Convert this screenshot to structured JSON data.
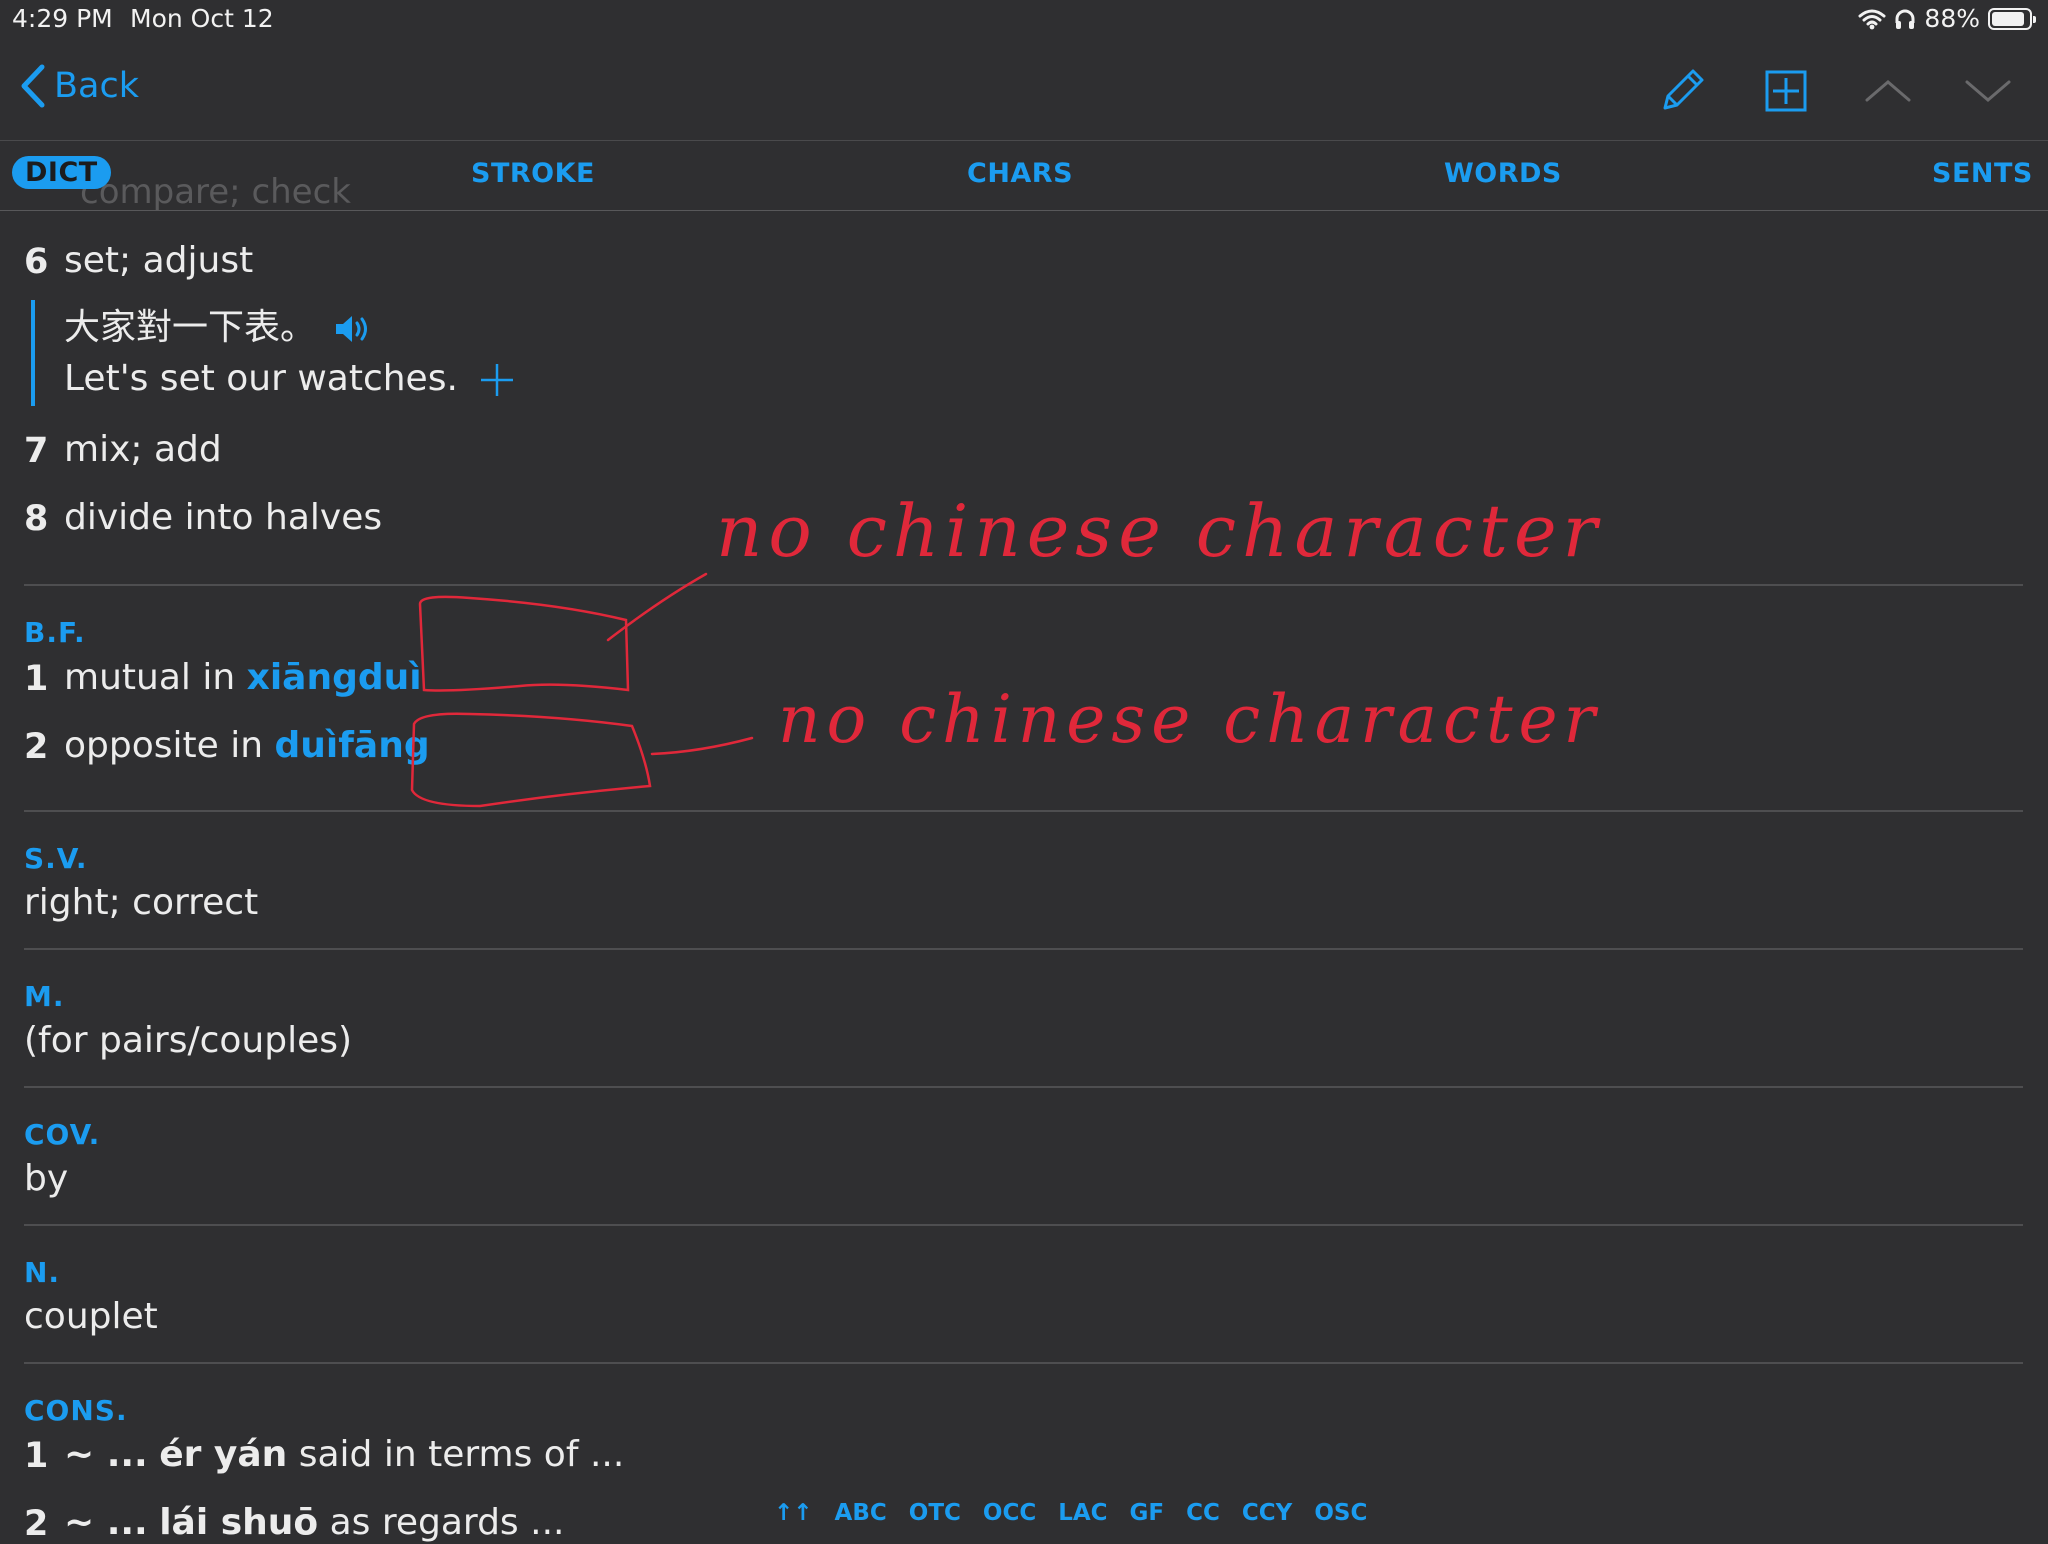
{
  "status_bar": {
    "time": "4:29 PM",
    "date": "Mon Oct 12",
    "battery": "88%",
    "battery_level": 0.88,
    "icons": [
      "wifi-icon",
      "headphones-icon",
      "battery-icon"
    ]
  },
  "nav": {
    "back_label": "Back",
    "icons": [
      "pencil-icon",
      "add-box-icon",
      "chevron-up-icon",
      "chevron-down-icon"
    ]
  },
  "tabs": [
    {
      "label": "DICT",
      "active": true
    },
    {
      "label": "STROKE"
    },
    {
      "label": "CHARS"
    },
    {
      "label": "WORDS"
    },
    {
      "label": "SENTS"
    }
  ],
  "ghost_text": "compare; check",
  "definitions": [
    {
      "num": "6",
      "text": "set; adjust"
    },
    {
      "num": "7",
      "text": "mix; add"
    },
    {
      "num": "8",
      "text": "divide into halves"
    }
  ],
  "example": {
    "chinese": "大家對一下表。",
    "english": "Let's set our watches."
  },
  "bf": {
    "heading": "B.F.",
    "items": [
      {
        "num": "1",
        "text": "mutual in",
        "link": "xiāngduì"
      },
      {
        "num": "2",
        "text": "opposite in",
        "link": "duìfāng"
      }
    ]
  },
  "sv": {
    "heading": "S.V.",
    "text": "right; correct"
  },
  "m": {
    "heading": "M.",
    "text": "(for pairs/couples)"
  },
  "cov": {
    "heading": "COV.",
    "text": "by"
  },
  "n": {
    "heading": "N.",
    "text": "couplet"
  },
  "cons": {
    "heading": "CONS.",
    "items": [
      {
        "num": "1",
        "prefix": "~ ...",
        "pinyin": "ér yán",
        "text": "said in terms of ..."
      },
      {
        "num": "2",
        "prefix": "~ ...",
        "pinyin": "lái shuō",
        "text": "as regards ..."
      }
    ]
  },
  "bottom_index": [
    "↑↑",
    "ABC",
    "OTC",
    "OCC",
    "LAC",
    "GF",
    "CC",
    "CCY",
    "OSC"
  ],
  "annotations": {
    "note_1": "no chinese character",
    "note_2": "no chinese character",
    "ink_color": "#e0283a"
  },
  "colors": {
    "accent": "#1b9cf0",
    "background": "#2f2f31"
  }
}
